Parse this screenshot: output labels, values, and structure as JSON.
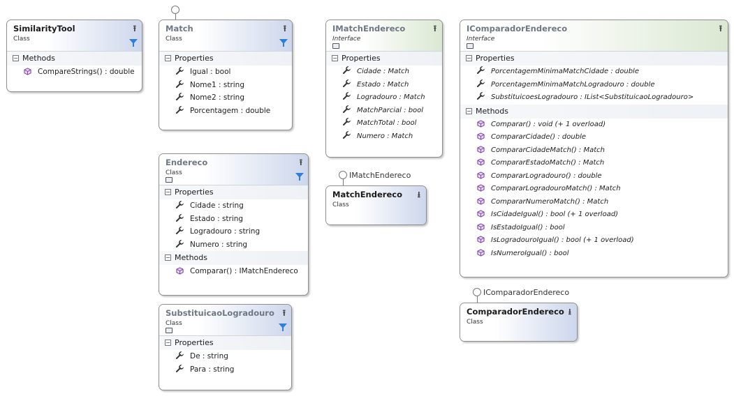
{
  "similarity_tool": {
    "name": "SimilarityTool",
    "kind": "Class",
    "methods_label": "Methods",
    "methods": [
      "CompareStrings() : double"
    ]
  },
  "match": {
    "name": "Match",
    "kind": "Class",
    "properties_label": "Properties",
    "properties": [
      "Igual : bool",
      "Nome1 : string",
      "Nome2 : string",
      "Porcentagem : double"
    ]
  },
  "endereco": {
    "name": "Endereco",
    "kind": "Class",
    "properties_label": "Properties",
    "properties": [
      "Cidade : string",
      "Estado : string",
      "Logradouro : string",
      "Numero : string"
    ],
    "methods_label": "Methods",
    "methods": [
      "Comparar() : IMatchEndereco"
    ]
  },
  "substituicao": {
    "name": "SubstituicaoLogradouro",
    "kind": "Class",
    "properties_label": "Properties",
    "properties": [
      "De : string",
      "Para : string"
    ]
  },
  "imatch_endereco": {
    "name": "IMatchEndereco",
    "kind": "Interface",
    "properties_label": "Properties",
    "properties": [
      "Cidade : Match",
      "Estado : Match",
      "Logradouro : Match",
      "MatchParcial : bool",
      "MatchTotal : bool",
      "Numero : Match"
    ]
  },
  "match_endereco": {
    "name": "MatchEndereco",
    "kind": "Class",
    "implements": "IMatchEndereco"
  },
  "icomparador": {
    "name": "IComparadorEndereco",
    "kind": "Interface",
    "properties_label": "Properties",
    "properties": [
      "PorcentagemMinimaMatchCidade : double",
      "PorcentagemMinimaMatchLogradouro : double",
      "SubstituicoesLogradouro : IList<SubstituicaoLogradouro>"
    ],
    "methods_label": "Methods",
    "methods": [
      "Comparar() : void (+ 1 overload)",
      "CompararCidade() : double",
      "CompararCidadeMatch() : Match",
      "CompararEstadoMatch() : Match",
      "CompararLogradouro() : double",
      "CompararLogradouroMatch() : Match",
      "CompararNumeroMatch() : Match",
      "IsCidadeIgual() : bool (+ 1 overload)",
      "IsEstadoIgual() : bool",
      "IsLogradouroIgual() : bool (+ 1 overload)",
      "IsNumeroIgual() : bool"
    ]
  },
  "comparador": {
    "name": "ComparadorEndereco",
    "kind": "Class",
    "implements": "IComparadorEndereco"
  },
  "icons": {
    "property": "wrench-icon",
    "method": "cube-icon",
    "collapse": "double-chevron-up-icon",
    "expand": "double-chevron-down-icon",
    "filter": "filter-icon",
    "lollipop": "interface-lollipop-icon"
  },
  "colors": {
    "class_header": "#cdd7ec",
    "interface_header": "#dbe8d2",
    "filter": "#2f7ed8",
    "method_icon": "#7b3fa0"
  }
}
